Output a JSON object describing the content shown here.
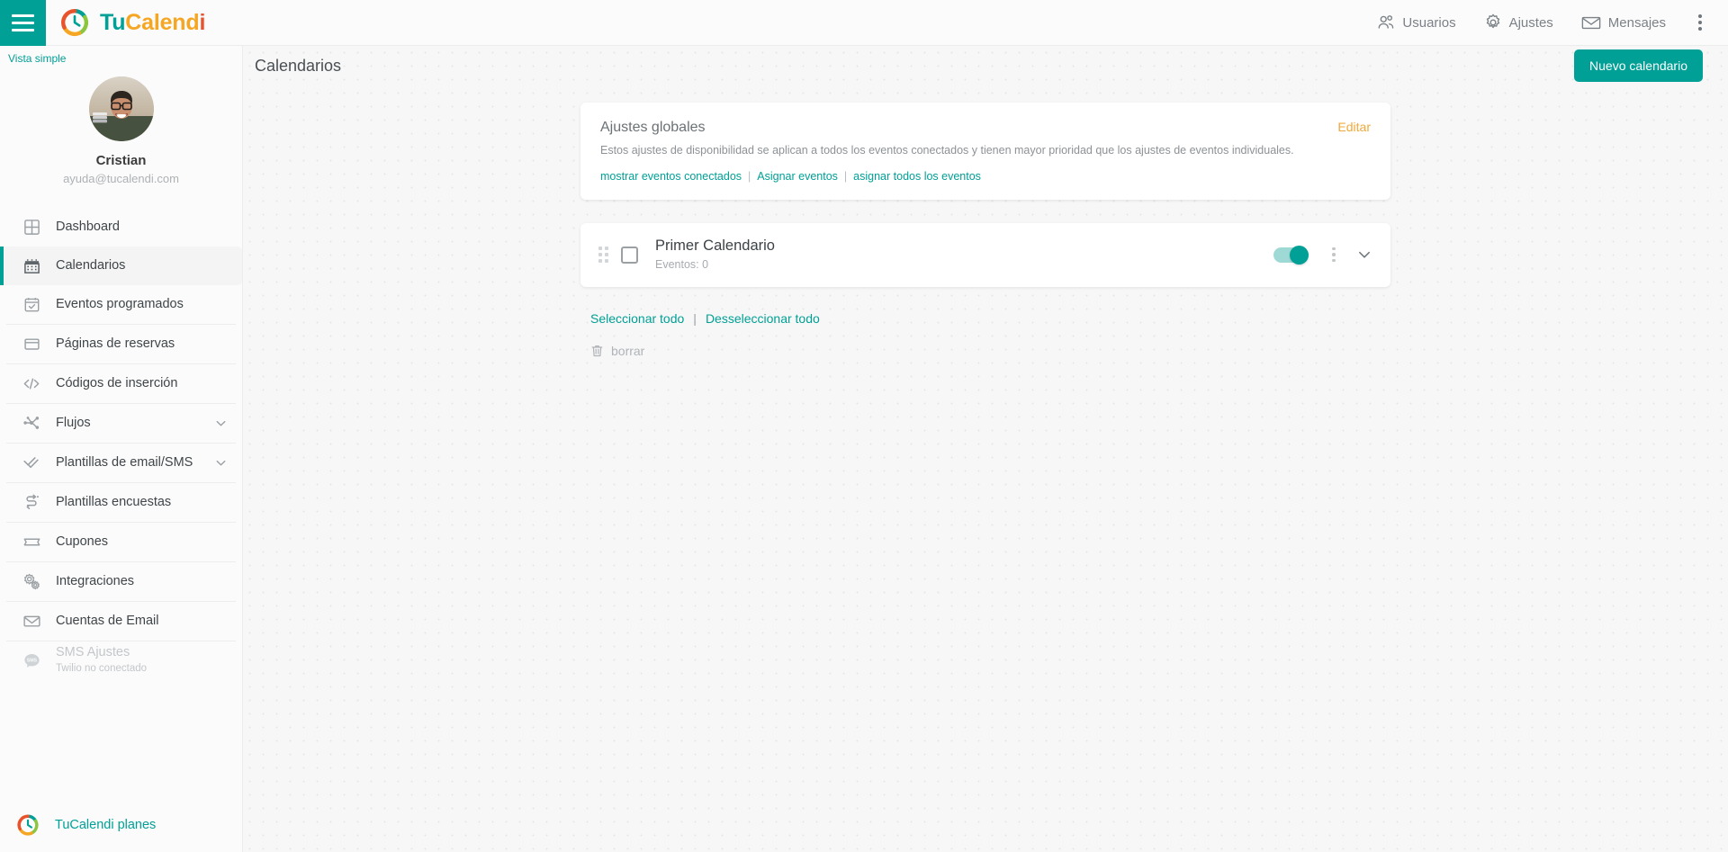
{
  "topbar": {
    "menu_icon": "hamburger-icon",
    "brand": {
      "part1": "Tu",
      "part2": "Calend",
      "part3": "i"
    },
    "nav": [
      {
        "label": "Usuarios",
        "icon": "users-icon"
      },
      {
        "label": "Ajustes",
        "icon": "gear-icon"
      },
      {
        "label": "Mensajes",
        "icon": "envelope-icon"
      }
    ],
    "overflow_icon": "kebab-menu-icon"
  },
  "sidebar": {
    "simple_view_label": "Vista simple",
    "profile": {
      "name": "Cristian",
      "email": "ayuda@tucalendi.com",
      "avatar": "user-avatar"
    },
    "items": [
      {
        "label": "Dashboard",
        "icon": "grid-icon",
        "active": false,
        "expandable": false
      },
      {
        "label": "Calendarios",
        "icon": "calendar-icon",
        "active": true,
        "expandable": false
      },
      {
        "label": "Eventos programados",
        "icon": "calendar-check-icon",
        "active": false,
        "expandable": false
      },
      {
        "label": "Páginas de reservas",
        "icon": "window-icon",
        "active": false,
        "expandable": false
      },
      {
        "label": "Códigos de inserción",
        "icon": "code-icon",
        "active": false,
        "expandable": false
      },
      {
        "label": "Flujos",
        "icon": "flow-icon",
        "active": false,
        "expandable": true
      },
      {
        "label": "Plantillas de email/SMS",
        "icon": "double-check-icon",
        "active": false,
        "expandable": true
      },
      {
        "label": "Plantillas encuestas",
        "icon": "survey-icon",
        "active": false,
        "expandable": false
      },
      {
        "label": "Cupones",
        "icon": "ticket-icon",
        "active": false,
        "expandable": false
      },
      {
        "label": "Integraciones",
        "icon": "gears-icon",
        "active": false,
        "expandable": false
      },
      {
        "label": "Cuentas de Email",
        "icon": "mail-icon",
        "active": false,
        "expandable": false
      },
      {
        "label": "SMS Ajustes",
        "sublabel": "Twilio no conectado",
        "icon": "sms-bubble-icon",
        "active": false,
        "expandable": false,
        "disabled": true
      }
    ],
    "footer": {
      "label": "TuCalendi planes",
      "icon": "tucalendi-logo-icon"
    }
  },
  "main": {
    "page_title": "Calendarios",
    "new_calendar_button": "Nuevo calendario",
    "global_settings": {
      "title": "Ajustes globales",
      "description": "Estos ajustes de disponibilidad se aplican a todos los eventos conectados y tienen mayor prioridad que los ajustes de eventos individuales.",
      "edit_label": "Editar",
      "links": [
        "mostrar eventos conectados",
        "Asignar eventos",
        "asignar todos los eventos"
      ],
      "separator": "|"
    },
    "calendars": [
      {
        "name": "Primer Calendario",
        "events_label": "Eventos: 0",
        "enabled": true,
        "checked": false
      }
    ],
    "select_all_label": "Seleccionar todo",
    "deselect_all_label": "Desseleccionar todo",
    "select_separator": "|",
    "delete_label": "borrar"
  },
  "colors": {
    "accent": "#00a096",
    "edit_link": "#f0a93c",
    "logo_red": "#e8532d",
    "logo_amber": "#f5a623",
    "logo_green": "#8cc63e"
  }
}
